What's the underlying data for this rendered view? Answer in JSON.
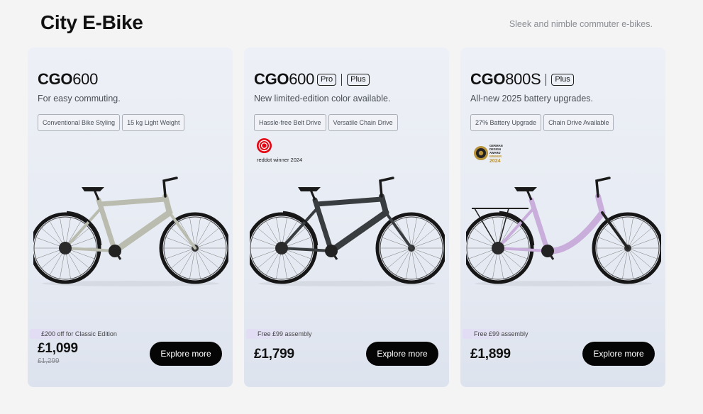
{
  "header": {
    "title": "City E-Bike",
    "subtitle": "Sleek and nimble commuter e-bikes."
  },
  "cards": [
    {
      "model_bold": "CGO",
      "model_num": "600",
      "tagline": "For easy commuting.",
      "chips": [
        "Conventional Bike Styling",
        "15 kg Light Weight"
      ],
      "bike_color": "#b9bcae",
      "promo": "£200 off for Classic Edition",
      "price": "£1,099",
      "old_price": "£1,299",
      "button": "Explore more"
    },
    {
      "model_bold": "CGO",
      "model_num": "600",
      "variant_tag": "Pro",
      "plus_tag": "Plus",
      "tagline": "New limited-edition color available.",
      "chips": [
        "Hassle-free Belt Drive",
        "Versatile Chain Drive"
      ],
      "award": "reddot winner 2024",
      "bike_color": "#3a3d40",
      "promo": "Free £99 assembly",
      "price": "£1,799",
      "button": "Explore more"
    },
    {
      "model_bold": "CGO",
      "model_num": "800S",
      "plus_tag": "Plus",
      "tagline": "All-new 2025 battery upgrades.",
      "chips": [
        "27% Battery Upgrade",
        "Chain Drive Available"
      ],
      "award_lines": [
        "GERMAN",
        "DESIGN",
        "AWARD",
        "WINNER",
        "2024"
      ],
      "bike_color": "#c9addb",
      "promo": "Free £99 assembly",
      "price": "£1,899",
      "button": "Explore more"
    }
  ]
}
